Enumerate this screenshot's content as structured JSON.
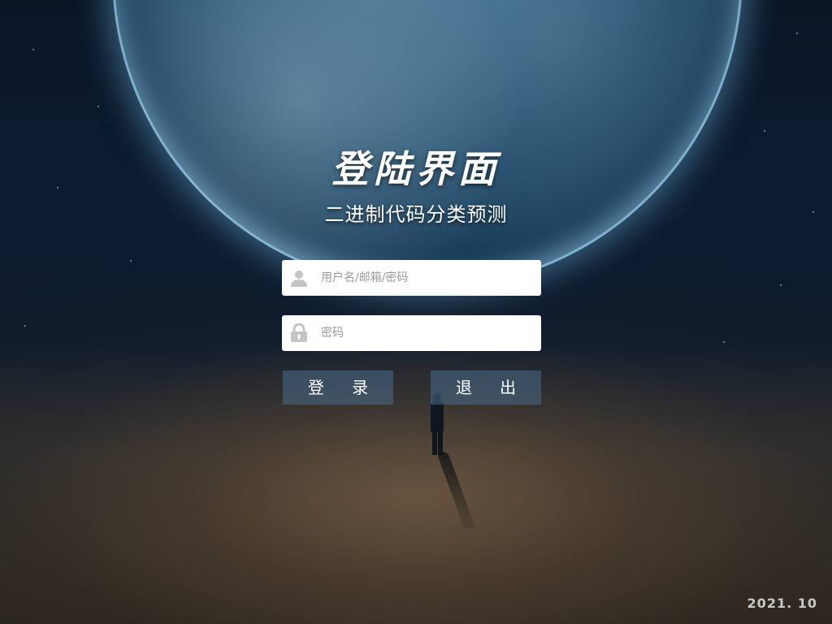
{
  "header": {
    "title": "登陆界面",
    "subtitle": "二进制代码分类预测"
  },
  "form": {
    "username": {
      "placeholder": "用户名/邮箱/密码",
      "value": "",
      "icon": "user-icon"
    },
    "password": {
      "placeholder": "密码",
      "value": "",
      "icon": "lock-icon"
    }
  },
  "buttons": {
    "login_label": "登 录",
    "exit_label": "退 出"
  },
  "footer": {
    "date": "2021. 10"
  },
  "colors": {
    "button_bg": "#486c8c",
    "field_bg": "#ffffff",
    "placeholder": "#9a9a9a",
    "text": "#ffffff"
  }
}
